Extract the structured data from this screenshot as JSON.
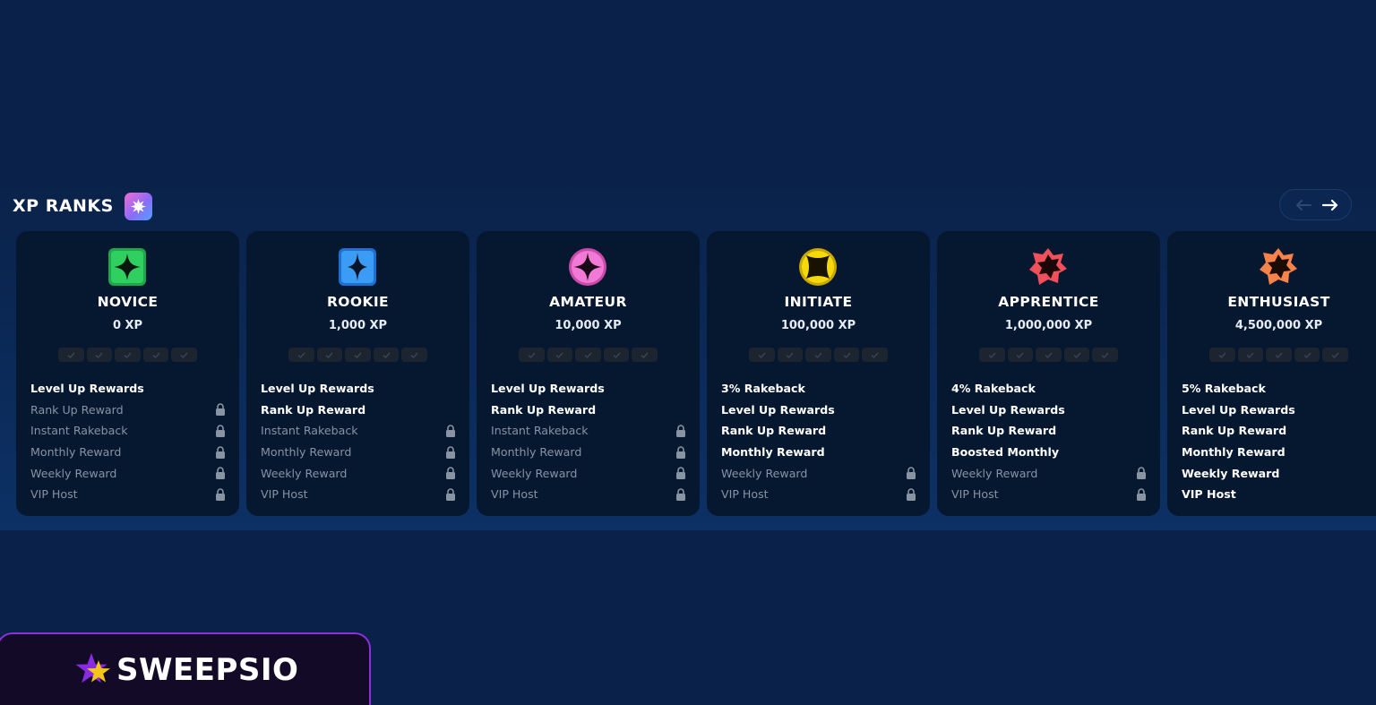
{
  "section": {
    "title": "XP RANKS",
    "title_badge_icon": "sparkle-badge-icon"
  },
  "navigation": {
    "prev_icon": "arrow-left-icon",
    "next_icon": "arrow-right-icon",
    "prev_enabled": false,
    "next_enabled": true
  },
  "ranks": [
    {
      "name": "NOVICE",
      "xp": "0 XP",
      "icon": "novice-star-icon",
      "color": "#22c55e",
      "perks": [
        {
          "label": "Level Up Rewards",
          "unlocked": true
        },
        {
          "label": "Rank Up Reward",
          "unlocked": false
        },
        {
          "label": "Instant Rakeback",
          "unlocked": false
        },
        {
          "label": "Monthly Reward",
          "unlocked": false
        },
        {
          "label": "Weekly Reward",
          "unlocked": false
        },
        {
          "label": "VIP Host",
          "unlocked": false
        }
      ]
    },
    {
      "name": "ROOKIE",
      "xp": "1,000 XP",
      "icon": "rookie-star-icon",
      "color": "#3b9cf6",
      "perks": [
        {
          "label": "Level Up Rewards",
          "unlocked": true
        },
        {
          "label": "Rank Up Reward",
          "unlocked": true
        },
        {
          "label": "Instant Rakeback",
          "unlocked": false
        },
        {
          "label": "Monthly Reward",
          "unlocked": false
        },
        {
          "label": "Weekly Reward",
          "unlocked": false
        },
        {
          "label": "VIP Host",
          "unlocked": false
        }
      ]
    },
    {
      "name": "AMATEUR",
      "xp": "10,000 XP",
      "icon": "amateur-star-icon",
      "color": "#f27ad6",
      "perks": [
        {
          "label": "Level Up Rewards",
          "unlocked": true
        },
        {
          "label": "Rank Up Reward",
          "unlocked": true
        },
        {
          "label": "Instant Rakeback",
          "unlocked": false
        },
        {
          "label": "Monthly Reward",
          "unlocked": false
        },
        {
          "label": "Weekly Reward",
          "unlocked": false
        },
        {
          "label": "VIP Host",
          "unlocked": false
        }
      ]
    },
    {
      "name": "INITIATE",
      "xp": "100,000 XP",
      "icon": "initiate-star-icon",
      "color": "#f5d90a",
      "perks": [
        {
          "label": "3% Rakeback",
          "unlocked": true
        },
        {
          "label": "Level Up Rewards",
          "unlocked": true
        },
        {
          "label": "Rank Up Reward",
          "unlocked": true
        },
        {
          "label": "Monthly Reward",
          "unlocked": true
        },
        {
          "label": "Weekly Reward",
          "unlocked": false
        },
        {
          "label": "VIP Host",
          "unlocked": false
        }
      ]
    },
    {
      "name": "APPRENTICE",
      "xp": "1,000,000 XP",
      "icon": "apprentice-badge-icon",
      "color": "#f0505a",
      "perks": [
        {
          "label": "4% Rakeback",
          "unlocked": true
        },
        {
          "label": "Level Up Rewards",
          "unlocked": true
        },
        {
          "label": "Rank Up Reward",
          "unlocked": true
        },
        {
          "label": "Boosted Monthly",
          "unlocked": true
        },
        {
          "label": "Weekly Reward",
          "unlocked": false
        },
        {
          "label": "VIP Host",
          "unlocked": false
        }
      ]
    },
    {
      "name": "ENTHUSIAST",
      "xp": "4,500,000 XP",
      "icon": "enthusiast-badge-icon",
      "color": "#f7834a",
      "perks": [
        {
          "label": "5% Rakeback",
          "unlocked": true
        },
        {
          "label": "Level Up Rewards",
          "unlocked": true
        },
        {
          "label": "Rank Up Reward",
          "unlocked": true
        },
        {
          "label": "Monthly Reward",
          "unlocked": true
        },
        {
          "label": "Weekly Reward",
          "unlocked": true
        },
        {
          "label": "VIP Host",
          "unlocked": true
        }
      ]
    }
  ],
  "brand": {
    "name": "SWEEPSIO",
    "logo_icon": "sweepsio-star-icon"
  }
}
